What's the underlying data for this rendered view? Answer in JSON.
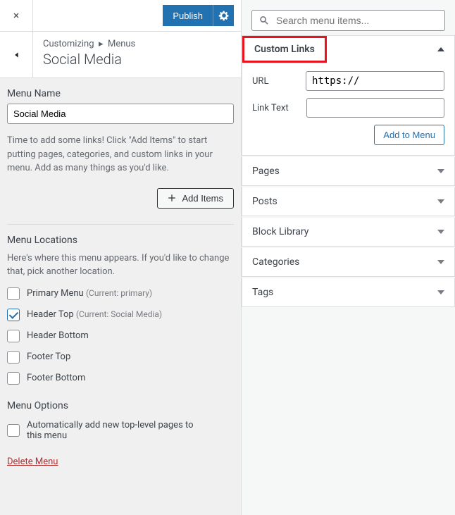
{
  "topbar": {
    "publish": "Publish"
  },
  "breadcrumb": {
    "root": "Customizing",
    "section": "Menus"
  },
  "title": "Social Media",
  "menuName": {
    "label": "Menu Name",
    "value": "Social Media"
  },
  "help": "Time to add some links! Click \"Add Items\" to start putting pages, categories, and custom links in your menu. Add as many things as you'd like.",
  "addItems": "Add Items",
  "locations": {
    "title": "Menu Locations",
    "help": "Here's where this menu appears. If you'd like to change that, pick another location.",
    "items": [
      {
        "label": "Primary Menu",
        "sub": "(Current: primary)",
        "checked": false
      },
      {
        "label": "Header Top",
        "sub": "(Current: Social Media)",
        "checked": true
      },
      {
        "label": "Header Bottom",
        "sub": "",
        "checked": false
      },
      {
        "label": "Footer Top",
        "sub": "",
        "checked": false
      },
      {
        "label": "Footer Bottom",
        "sub": "",
        "checked": false
      }
    ]
  },
  "options": {
    "title": "Menu Options",
    "auto": "Automatically add new top-level pages to this menu"
  },
  "deleteMenu": "Delete Menu",
  "search": {
    "placeholder": "Search menu items..."
  },
  "customLinks": {
    "title": "Custom Links",
    "urlLabel": "URL",
    "urlValue": "https://",
    "textLabel": "Link Text",
    "addBtn": "Add to Menu"
  },
  "sections": [
    "Pages",
    "Posts",
    "Block Library",
    "Categories",
    "Tags"
  ]
}
